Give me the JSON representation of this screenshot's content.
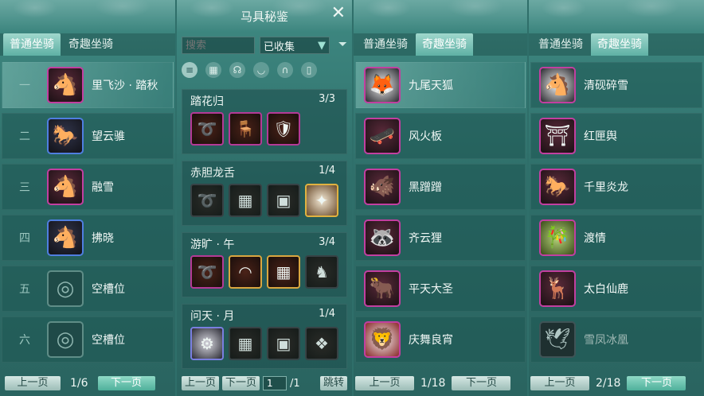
{
  "panel1": {
    "tabs": [
      "普通坐骑",
      "奇趣坐骑"
    ],
    "rows": [
      {
        "num": "一",
        "name": "里飞沙 · 踏秋",
        "icon": "white-horse-icon"
      },
      {
        "num": "二",
        "name": "望云骓",
        "icon": "black-horse-icon"
      },
      {
        "num": "三",
        "name": "融雪",
        "icon": "white-horse-icon"
      },
      {
        "num": "四",
        "name": "拂晓",
        "icon": "red-horse-icon"
      },
      {
        "num": "五",
        "name": "空槽位",
        "icon": "empty-slot-icon"
      },
      {
        "num": "六",
        "name": "空槽位",
        "icon": "empty-slot-icon"
      }
    ],
    "prev": "上一页",
    "page": "1/6",
    "next": "下一页"
  },
  "panel2": {
    "title": "马具秘鉴",
    "search_placeholder": "搜索",
    "filter_value": "已收集",
    "sets": [
      {
        "name": "踏花归",
        "count": "3/3"
      },
      {
        "name": "赤胆龙舌",
        "count": "1/4"
      },
      {
        "name": "游旷 · 午",
        "count": "3/4"
      },
      {
        "name": "问天 · 月",
        "count": "1/4"
      }
    ],
    "prev": "上一页",
    "next": "下一页",
    "page_input": "1",
    "page_total": "/1",
    "jump": "跳转"
  },
  "panel3": {
    "tabs": [
      "普通坐骑",
      "奇趣坐骑"
    ],
    "rows": [
      {
        "name": "九尾天狐",
        "icon": "fox-icon"
      },
      {
        "name": "风火板",
        "icon": "skateboard-icon"
      },
      {
        "name": "黑蹭蹭",
        "icon": "boar-icon"
      },
      {
        "name": "齐云狸",
        "icon": "raccoon-icon"
      },
      {
        "name": "平天大圣",
        "icon": "bull-icon"
      },
      {
        "name": "庆舞良宵",
        "icon": "lion-dance-icon"
      }
    ],
    "prev": "上一页",
    "page": "1/18",
    "next": "下一页"
  },
  "panel4": {
    "tabs": [
      "普通坐骑",
      "奇趣坐骑"
    ],
    "rows": [
      {
        "name": "清砚碎雪",
        "icon": "white-horse-icon"
      },
      {
        "name": "红匣舆",
        "icon": "sedan-icon"
      },
      {
        "name": "千里炎龙",
        "icon": "dark-horse-icon"
      },
      {
        "name": "渡情",
        "icon": "bamboo-raft-icon"
      },
      {
        "name": "太白仙鹿",
        "icon": "antler-icon"
      },
      {
        "name": "雪凤冰凰",
        "icon": "phoenix-icon"
      }
    ],
    "prev": "上一页",
    "page": "2/18",
    "next": "下一页"
  }
}
